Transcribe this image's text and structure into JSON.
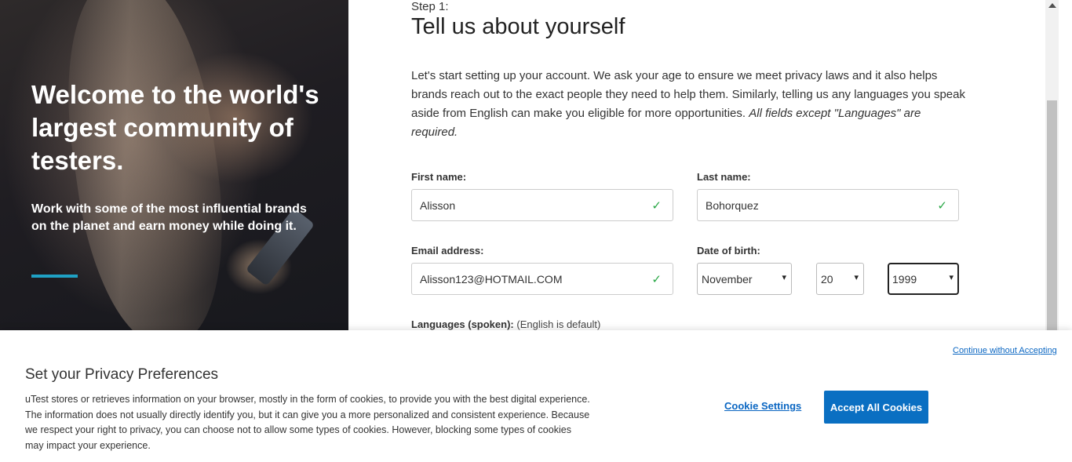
{
  "hero": {
    "title": "Welcome to the world's largest community of testers.",
    "subtitle": "Work with some of the most influential brands on the planet and earn money while doing it.",
    "accent_color": "#1fa1c4"
  },
  "form": {
    "step_label": "Step 1:",
    "title": "Tell us about yourself",
    "intro_text": "Let's start setting up your account. We ask your age to ensure we meet privacy laws and it also helps brands reach out to the exact people they need to help them. Similarly, telling us any languages you speak aside from English can make you eligible for more opportunities.",
    "intro_note": "All fields except \"Languages\" are required.",
    "first_name": {
      "label": "First name:",
      "value": "Alisson",
      "icon": "check-icon"
    },
    "last_name": {
      "label": "Last name:",
      "value": "Bohorquez",
      "icon": "check-icon"
    },
    "email": {
      "label": "Email address:",
      "value": "Alisson123@HOTMAIL.COM",
      "icon": "check-icon"
    },
    "dob": {
      "label": "Date of birth:",
      "month": "November",
      "day": "20",
      "year": "1999"
    },
    "languages": {
      "label": "Languages (spoken):",
      "hint": "(English is default)"
    },
    "check_color": "#28a745"
  },
  "cookie_banner": {
    "continue_link": "Continue without Accepting",
    "title": "Set your Privacy Preferences",
    "text": "uTest stores or retrieves information on your browser, mostly in the form of cookies, to provide you with the best digital experience. The information does not usually directly identify you, but it can give you a more personalized and consistent experience. Because we respect your right to privacy, you can choose not to allow some types of cookies. However, blocking some types of cookies may impact your experience.",
    "settings_link": "Cookie Settings",
    "accept_button": "Accept All Cookies",
    "accent_color": "#0a6fc2"
  }
}
